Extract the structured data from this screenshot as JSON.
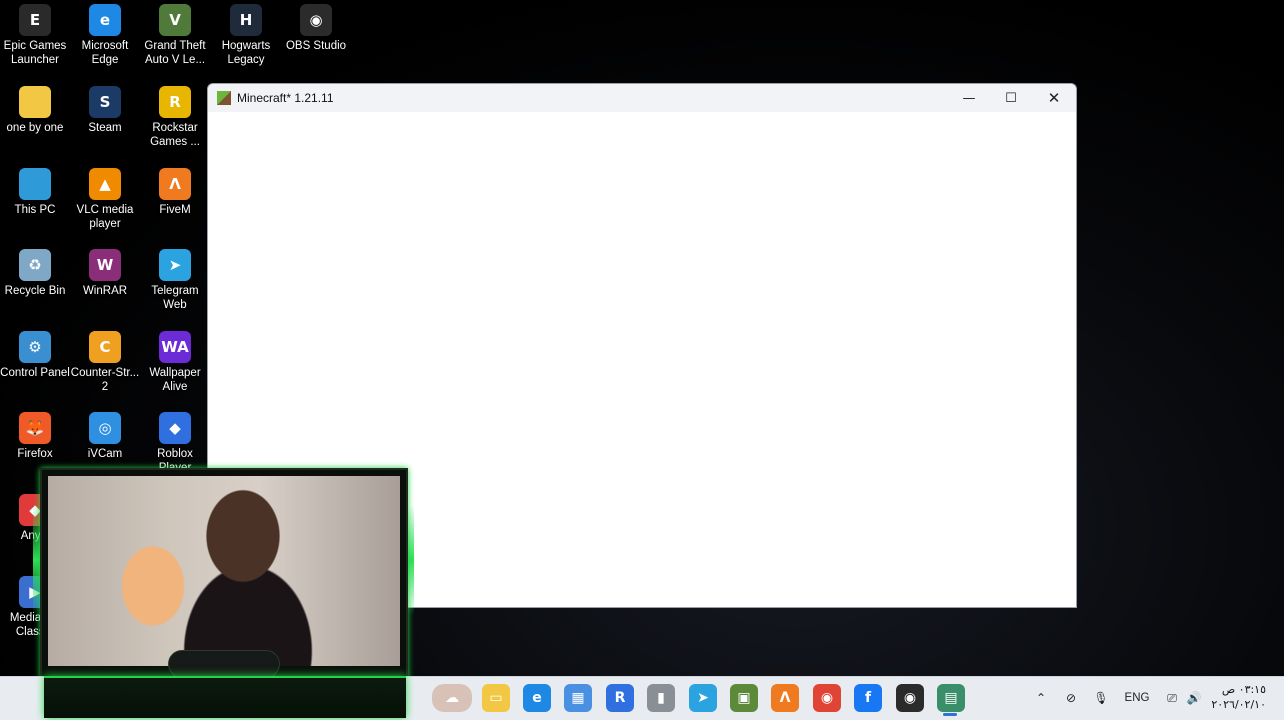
{
  "desktop_icons": [
    {
      "label": "Epic Games Launcher",
      "icon": "epic-games-icon",
      "color": "#2a2a2a",
      "glyph": "E"
    },
    {
      "label": "Microsoft Edge",
      "icon": "edge-icon",
      "color": "#1e88e5",
      "glyph": "e"
    },
    {
      "label": "Grand Theft Auto V Le...",
      "icon": "gta-icon",
      "color": "#4f7a3a",
      "glyph": "V"
    },
    {
      "label": "Hogwarts Legacy",
      "icon": "hogwarts-icon",
      "color": "#1f2a3a",
      "glyph": "H"
    },
    {
      "label": "OBS Studio",
      "icon": "obs-icon",
      "color": "#2b2b2b",
      "glyph": "◉"
    },
    {
      "label": "one by one",
      "icon": "folder-icon",
      "color": "#f2c744",
      "glyph": ""
    },
    {
      "label": "Steam",
      "icon": "steam-icon",
      "color": "#1b3a66",
      "glyph": "S"
    },
    {
      "label": "Rockstar Games ...",
      "icon": "rockstar-icon",
      "color": "#e8b500",
      "glyph": "R"
    },
    {
      "label": "This PC",
      "icon": "monitor-icon",
      "color": "#2f9ad8",
      "glyph": ""
    },
    {
      "label": "VLC media player",
      "icon": "vlc-icon",
      "color": "#f08a00",
      "glyph": "▲"
    },
    {
      "label": "FiveM",
      "icon": "fivem-icon",
      "color": "#f07a20",
      "glyph": "Λ"
    },
    {
      "label": "Recycle Bin",
      "icon": "recycle-bin-icon",
      "color": "#7fa7c6",
      "glyph": "♻"
    },
    {
      "label": "WinRAR",
      "icon": "winrar-icon",
      "color": "#8b2e7a",
      "glyph": "W"
    },
    {
      "label": "Telegram Web",
      "icon": "telegram-icon",
      "color": "#2aa3e0",
      "glyph": "➤"
    },
    {
      "label": "Control Panel",
      "icon": "control-panel-icon",
      "color": "#3a8fd0",
      "glyph": "⚙"
    },
    {
      "label": "Counter-Str... 2",
      "icon": "counter-strike-icon",
      "color": "#f0a020",
      "glyph": "C"
    },
    {
      "label": "Wallpaper Alive",
      "icon": "wallpaper-alive-icon",
      "color": "#6b2bd6",
      "glyph": "WA"
    },
    {
      "label": "Firefox",
      "icon": "firefox-icon",
      "color": "#f05a28",
      "glyph": "🦊"
    },
    {
      "label": "iVCam",
      "icon": "ivcam-icon",
      "color": "#2f8fe0",
      "glyph": "◎"
    },
    {
      "label": "Roblox Player",
      "icon": "roblox-icon",
      "color": "#2f6fe0",
      "glyph": "◆"
    },
    {
      "label": "Any...",
      "icon": "anydesk-icon",
      "color": "#e03a3a",
      "glyph": "◆"
    },
    {
      "label": "Media P... Class...",
      "icon": "media-player-classic-icon",
      "color": "#3a6fd0",
      "glyph": "▶"
    }
  ],
  "window": {
    "title": "Minecraft* 1.21.11",
    "minimize_glyph": "—",
    "maximize_glyph": "☐",
    "close_glyph": "✕"
  },
  "taskbar": {
    "apps": [
      {
        "icon": "weather-icon",
        "color": "#d8c2b8",
        "glyph": "☁"
      },
      {
        "icon": "file-explorer-icon",
        "color": "#f2c744",
        "glyph": "▭"
      },
      {
        "icon": "edge-icon",
        "color": "#1e88e5",
        "glyph": "e"
      },
      {
        "icon": "microsoft-store-icon",
        "color": "#4a90e2",
        "glyph": "▦"
      },
      {
        "icon": "rockstar-launcher-icon",
        "color": "#2f6fe0",
        "glyph": "R"
      },
      {
        "icon": "usb-drive-icon",
        "color": "#8a8f96",
        "glyph": "▮"
      },
      {
        "icon": "telegram-icon",
        "color": "#2aa3e0",
        "glyph": "➤"
      },
      {
        "icon": "minecraft-launcher-icon",
        "color": "#5c8a3a",
        "glyph": "▣"
      },
      {
        "icon": "fivem-icon",
        "color": "#f07a20",
        "glyph": "Λ"
      },
      {
        "icon": "chrome-icon",
        "color": "#e04434",
        "glyph": "◉"
      },
      {
        "icon": "facebook-icon",
        "color": "#1877f2",
        "glyph": "f"
      },
      {
        "icon": "obs-icon",
        "color": "#2b2b2b",
        "glyph": "◉"
      },
      {
        "icon": "minecraft-window-icon",
        "color": "#3a8f6a",
        "glyph": "▤"
      }
    ],
    "tray": {
      "chevron_glyph": "⌃",
      "network_glyph": "⊘",
      "mic_glyph": "🎙",
      "language": "ENG",
      "display_glyph": "⎚",
      "volume_glyph": "🔊"
    },
    "clock": {
      "time": "٠٣:١٥ ص",
      "date": "٢٠٢٦/٠٢/١٠"
    }
  }
}
